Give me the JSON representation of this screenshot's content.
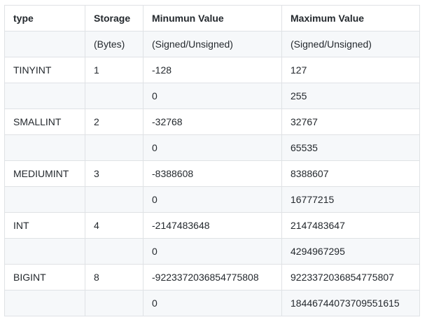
{
  "table": {
    "headers": [
      "type",
      "Storage",
      "Minumun Value",
      "Maximum Value"
    ],
    "rows": [
      [
        "",
        "(Bytes)",
        "(Signed/Unsigned)",
        "(Signed/Unsigned)"
      ],
      [
        "TINYINT",
        "1",
        "-128",
        "127"
      ],
      [
        "",
        "",
        "0",
        "255"
      ],
      [
        "SMALLINT",
        "2",
        "-32768",
        "32767"
      ],
      [
        "",
        "",
        "0",
        "65535"
      ],
      [
        "MEDIUMINT",
        "3",
        "-8388608",
        "8388607"
      ],
      [
        "",
        "",
        "0",
        "16777215"
      ],
      [
        "INT",
        "4",
        "-2147483648",
        "2147483647"
      ],
      [
        "",
        "",
        "0",
        "4294967295"
      ],
      [
        "BIGINT",
        "8",
        "-9223372036854775808",
        "9223372036854775807"
      ],
      [
        "",
        "",
        "0",
        "18446744073709551615"
      ]
    ]
  }
}
